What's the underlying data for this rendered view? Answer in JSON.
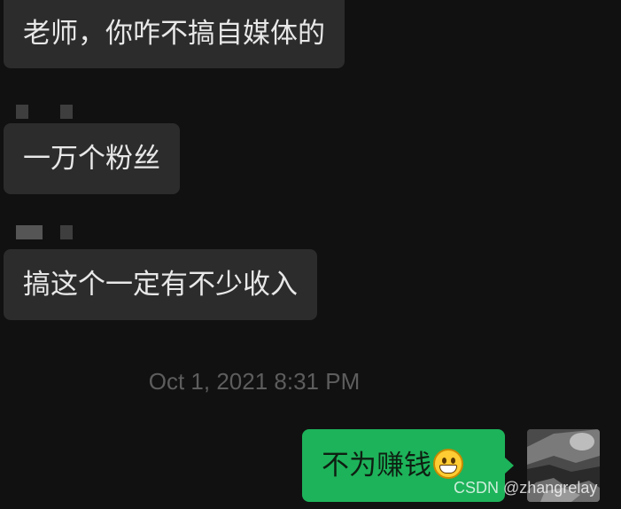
{
  "chat": {
    "messages_in": [
      {
        "text": "老师，你咋不搞自媒体的"
      },
      {
        "text": "一万个粉丝"
      },
      {
        "text": "搞这个一定有不少收入"
      }
    ],
    "timestamp": "Oct 1, 2021 8:31 PM",
    "message_out": {
      "text": "不为赚钱",
      "emoji": "grinning-face-icon"
    }
  },
  "watermark": "CSDN @zhangrelay",
  "colors": {
    "background": "#111111",
    "incoming_bubble": "#2c2c2c",
    "outgoing_bubble": "#1db35a",
    "timestamp": "#5d5d5d"
  }
}
